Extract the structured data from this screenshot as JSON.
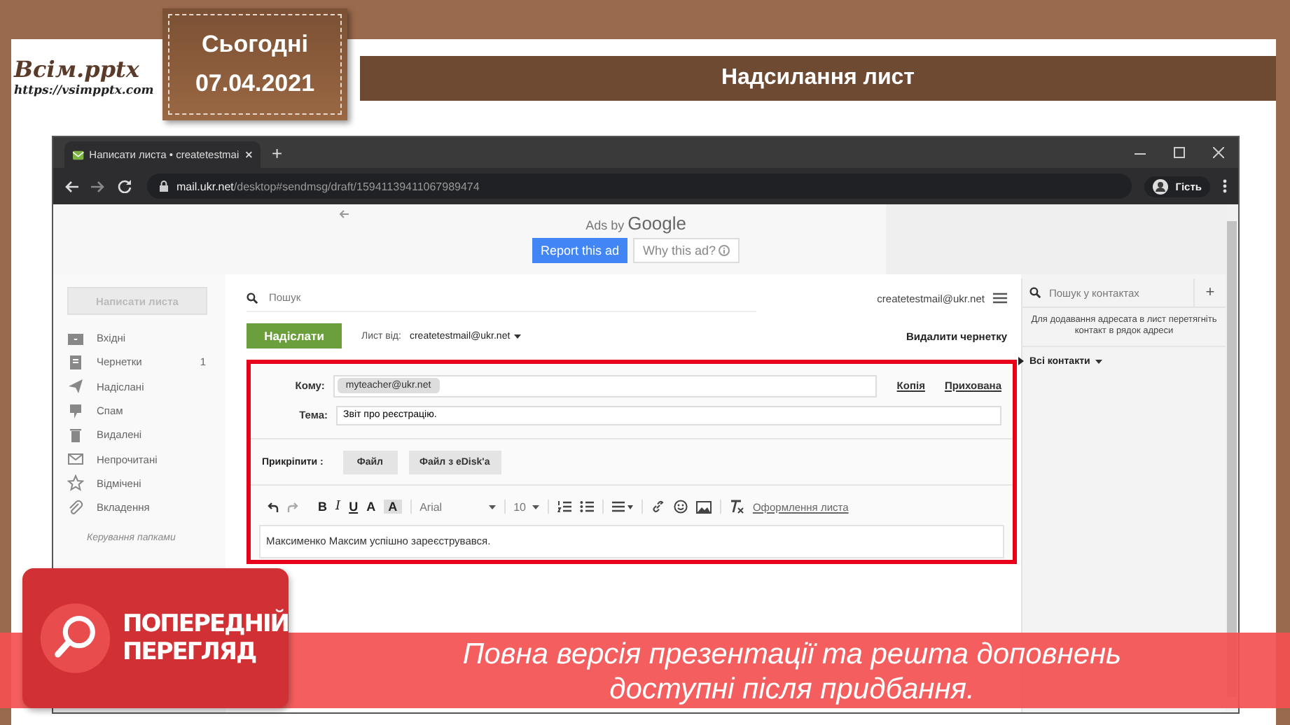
{
  "slide": {
    "logo": "Всім.pptx",
    "logo_url": "https://vsimpptx.com",
    "date_label": "Сьогодні",
    "date": "07.04.2021",
    "title": "Надсилання лист"
  },
  "browser": {
    "tab_title": "Написати листа • createtestmai",
    "new_tab": "+",
    "url_host": "mail.ukr.net",
    "url_path": "/desktop#sendmsg/draft/15941139411067989474",
    "profile": "Гість"
  },
  "ad": {
    "label": "Ads by",
    "brand": "Google",
    "report_button": "Report this ad",
    "why_button": "Why this ad?"
  },
  "mail": {
    "compose_button": "Написати листа",
    "folders": [
      {
        "label": "Вхідні",
        "selected": false
      },
      {
        "label": "Чернетки",
        "count": "1",
        "selected": false
      },
      {
        "label": "Надіслані",
        "selected": false
      },
      {
        "label": "Спам",
        "selected": false
      },
      {
        "label": "Видалені",
        "selected": false
      },
      {
        "label": "Непрочитані",
        "selected": false
      },
      {
        "label": "Відмічені",
        "selected": false
      },
      {
        "label": "Вкладення",
        "selected": false
      }
    ],
    "manage_folders": "Керування папками",
    "search_placeholder": "Пошук",
    "account": "createtestmail@ukr.net",
    "send_button": "Надіслати",
    "from_label": "Лист від:",
    "from_value": "createtestmail@ukr.net",
    "delete_draft": "Видалити чернетку",
    "to_label": "Кому:",
    "to_chip": "myteacher@ukr.net",
    "cc_link": "Копія",
    "bcc_link": "Прихована",
    "subject_label": "Тема:",
    "subject_value": "Звіт про реєстрацію.",
    "attach_label": "Прикріпити :",
    "attach_buttons": [
      "Файл",
      "Файл з eDisk'a"
    ],
    "format_glyphs": [
      "B",
      "I",
      "U",
      "A",
      "A"
    ],
    "font": "Arial",
    "font_size": "10",
    "format_link": "Оформлення листа",
    "body": "Максименко Максим успішно зареєструвався."
  },
  "contacts": {
    "search_placeholder": "Пошук у контактах",
    "add": "+",
    "hint": "Для додавання адресата в лист перетягніть контакт в рядок адреси",
    "all_contacts": "Всі контакти"
  },
  "preview_banner": {
    "badge_lines": [
      "ПОПЕРЕДНІЙ",
      "ПЕРЕГЛЯД"
    ],
    "message_lines": [
      "Повна версія презентації та решта доповнень",
      "доступні після придбання."
    ]
  }
}
